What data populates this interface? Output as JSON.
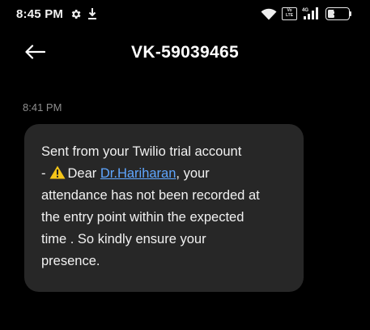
{
  "status_bar": {
    "time": "8:45 PM",
    "volte": "Vo\nLTE",
    "network": "4G",
    "battery": "35"
  },
  "header": {
    "title": "VK-59039465"
  },
  "message": {
    "time": "8:41 PM",
    "line1": "Sent from your Twilio trial account",
    "line2_prefix": "-",
    "line2_dear": "Dear",
    "line2_link": "Dr.Hariharan",
    "line2_suffix": ", your",
    "line3": "attendance has not been recorded at",
    "line4": "the entry point within the expected",
    "line5": "time . So kindly ensure your",
    "line6": "presence."
  },
  "colors": {
    "background": "#000000",
    "bubble": "#272727",
    "link": "#5fa6ff",
    "timestamp": "#8e8e8e",
    "warning": "#f5c518"
  }
}
